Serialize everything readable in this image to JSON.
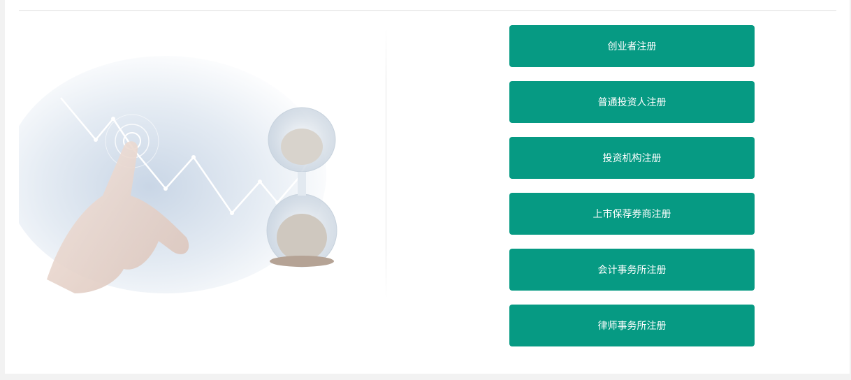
{
  "register": {
    "buttons": [
      {
        "label": "创业者注册"
      },
      {
        "label": "普通投资人注册"
      },
      {
        "label": "投资机构注册"
      },
      {
        "label": "上市保荐券商注册"
      },
      {
        "label": "会计事务所注册"
      },
      {
        "label": "律师事务所注册"
      }
    ]
  },
  "colors": {
    "button": "#069a83",
    "button_text": "#ffffff",
    "page_bg": "#f2f2f2"
  },
  "hero_image": {
    "icon": "hand-touching-chart-with-hourglass-illustration"
  }
}
